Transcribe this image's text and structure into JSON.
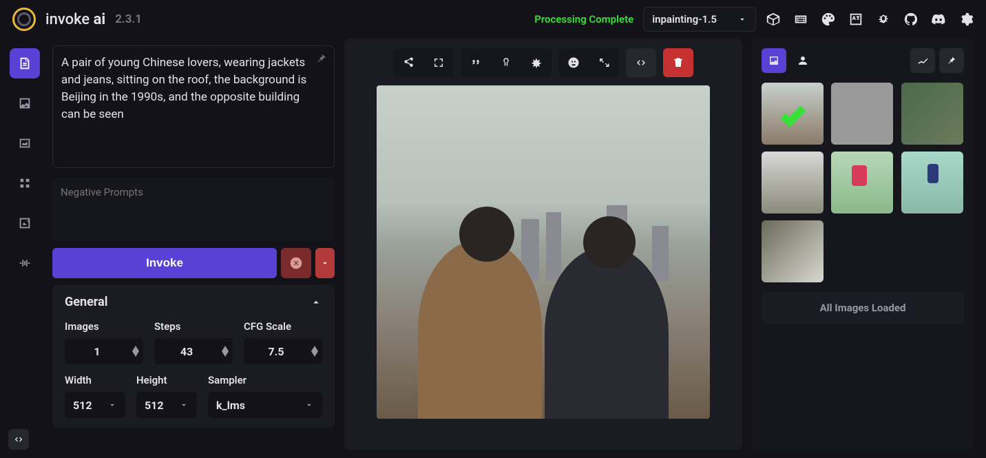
{
  "header": {
    "brand_pre": "invoke ",
    "brand_bold": "ai",
    "version": "2.3.1",
    "status": "Processing Complete",
    "model": "inpainting-1.5"
  },
  "prompt": "A pair of young Chinese lovers, wearing jackets and jeans, sitting on the roof, the background is Beijing in the 1990s, and the opposite building can be seen",
  "neg_placeholder": "Negative Prompts",
  "invoke_label": "Invoke",
  "general": {
    "title": "General",
    "images_label": "Images",
    "images": "1",
    "steps_label": "Steps",
    "steps": "43",
    "cfg_label": "CFG Scale",
    "cfg": "7.5",
    "width_label": "Width",
    "width": "512",
    "height_label": "Height",
    "height": "512",
    "sampler_label": "Sampler",
    "sampler": "k_lms"
  },
  "gallery": {
    "loaded": "All Images Loaded"
  }
}
